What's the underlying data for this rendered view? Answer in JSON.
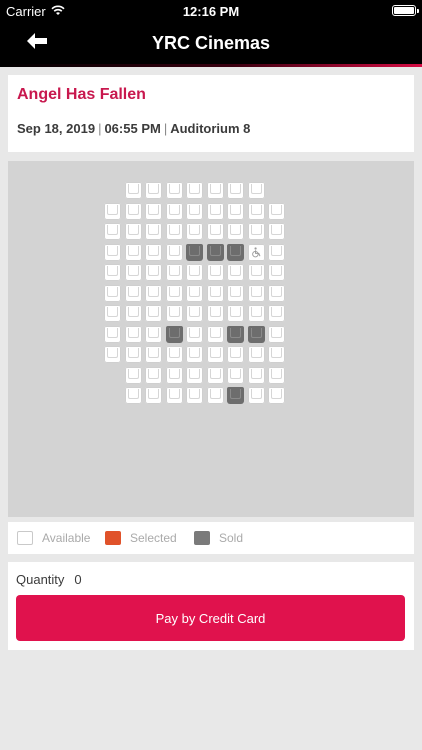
{
  "status_bar": {
    "carrier": "Carrier",
    "time": "12:16 PM"
  },
  "header": {
    "title": "YRC Cinemas"
  },
  "movie": {
    "title": "Angel Has Fallen",
    "date": "Sep 18, 2019",
    "time": "06:55 PM",
    "auditorium": "Auditorium 8"
  },
  "legend": {
    "available": "Available",
    "selected": "Selected",
    "sold": "Sold"
  },
  "checkout": {
    "quantity_label": "Quantity",
    "quantity_value": "0",
    "pay_button": "Pay by Credit Card"
  },
  "colors": {
    "brand_red": "#e0124d",
    "title_red": "#c8184e",
    "selected": "#e0522a",
    "sold": "#6d6d6d"
  },
  "seat_rows": [
    [
      "_",
      "A",
      "A",
      "A",
      "A",
      "A",
      "A",
      "A"
    ],
    [
      "A",
      "A",
      "A",
      "A",
      "A",
      "A",
      "A",
      "A",
      "A"
    ],
    [
      "A",
      "A",
      "A",
      "A",
      "A",
      "A",
      "A",
      "A",
      "A"
    ],
    [
      "A",
      "A",
      "A",
      "A",
      "S",
      "S",
      "S",
      "W",
      "A"
    ],
    [
      "A",
      "A",
      "A",
      "A",
      "A",
      "A",
      "A",
      "A",
      "A"
    ],
    [
      "A",
      "A",
      "A",
      "A",
      "A",
      "A",
      "A",
      "A",
      "A"
    ],
    [
      "A",
      "A",
      "A",
      "A",
      "A",
      "A",
      "A",
      "A",
      "A"
    ],
    [
      "A",
      "A",
      "A",
      "S",
      "A",
      "A",
      "S",
      "S",
      "A"
    ],
    [
      "A",
      "A",
      "A",
      "A",
      "A",
      "A",
      "A",
      "A",
      "A"
    ],
    [
      "_",
      "A",
      "A",
      "A",
      "A",
      "A",
      "A",
      "A",
      "A"
    ],
    [
      "_",
      "A",
      "A",
      "A",
      "A",
      "A",
      "S",
      "A",
      "A"
    ]
  ]
}
